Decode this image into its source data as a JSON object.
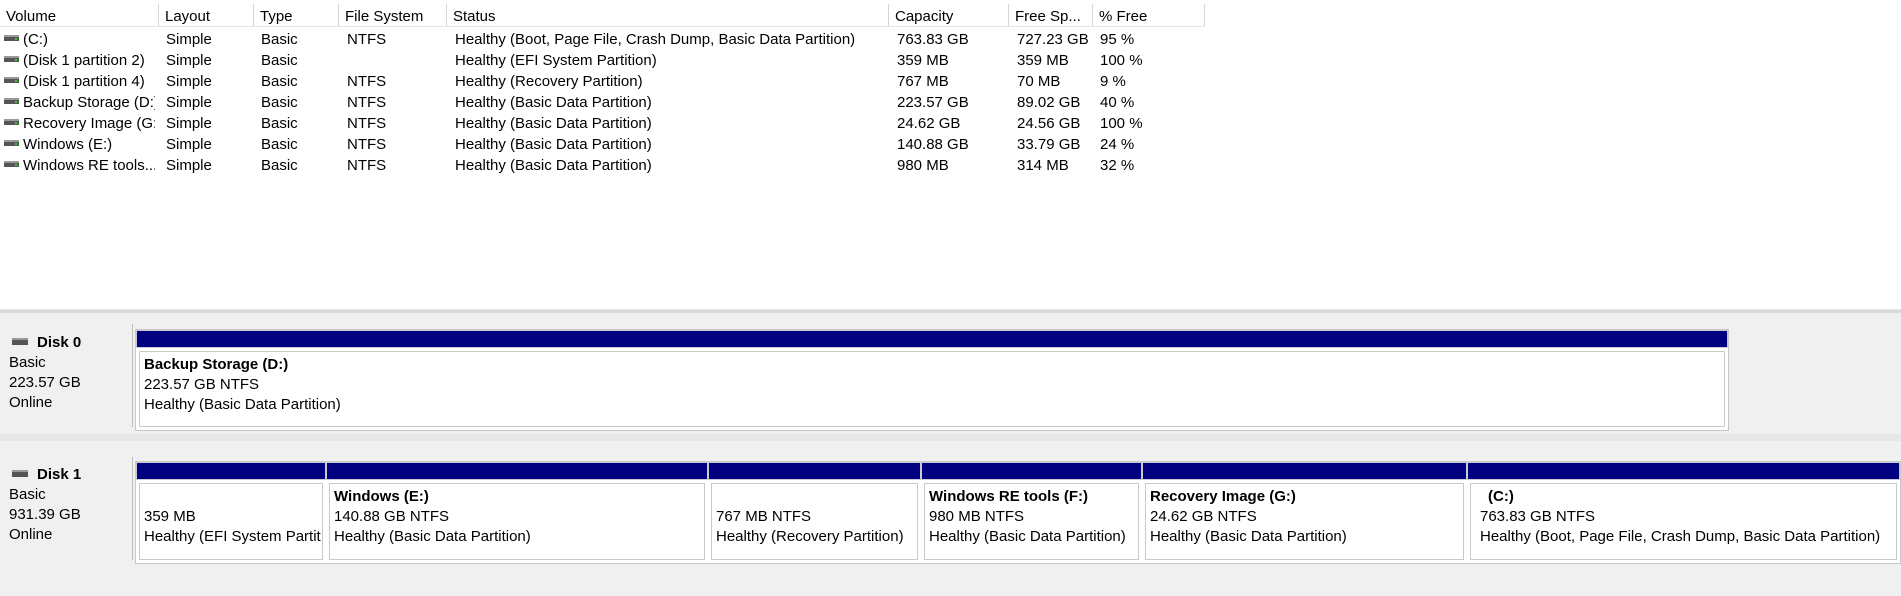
{
  "columns": [
    "Volume",
    "Layout",
    "Type",
    "File System",
    "Status",
    "Capacity",
    "Free Sp...",
    "% Free"
  ],
  "volumes": [
    {
      "volume": "(C:)",
      "layout": "Simple",
      "type": "Basic",
      "fs": "NTFS",
      "status": "Healthy (Boot, Page File, Crash Dump, Basic Data Partition)",
      "capacity": "763.83 GB",
      "free": "727.23 GB",
      "pct": "95 %"
    },
    {
      "volume": "(Disk 1 partition 2)",
      "layout": "Simple",
      "type": "Basic",
      "fs": "",
      "status": "Healthy (EFI System Partition)",
      "capacity": "359 MB",
      "free": "359 MB",
      "pct": "100 %"
    },
    {
      "volume": "(Disk 1 partition 4)",
      "layout": "Simple",
      "type": "Basic",
      "fs": "NTFS",
      "status": "Healthy (Recovery Partition)",
      "capacity": "767 MB",
      "free": "70 MB",
      "pct": "9 %"
    },
    {
      "volume": "Backup Storage (D:)",
      "layout": "Simple",
      "type": "Basic",
      "fs": "NTFS",
      "status": "Healthy (Basic Data Partition)",
      "capacity": "223.57 GB",
      "free": "89.02 GB",
      "pct": "40 %"
    },
    {
      "volume": "Recovery Image (G:)",
      "layout": "Simple",
      "type": "Basic",
      "fs": "NTFS",
      "status": "Healthy (Basic Data Partition)",
      "capacity": "24.62 GB",
      "free": "24.56 GB",
      "pct": "100 %"
    },
    {
      "volume": "Windows (E:)",
      "layout": "Simple",
      "type": "Basic",
      "fs": "NTFS",
      "status": "Healthy (Basic Data Partition)",
      "capacity": "140.88 GB",
      "free": "33.79 GB",
      "pct": "24 %"
    },
    {
      "volume": "Windows RE tools...",
      "layout": "Simple",
      "type": "Basic",
      "fs": "NTFS",
      "status": "Healthy (Basic Data Partition)",
      "capacity": "980 MB",
      "free": "314 MB",
      "pct": "32 %"
    }
  ],
  "disks": [
    {
      "name": "Disk 0",
      "type": "Basic",
      "size": "223.57 GB",
      "status": "Online",
      "partitions": [
        {
          "title": "Backup Storage  (D:)",
          "size": "223.57 GB NTFS",
          "status": "Healthy (Basic Data Partition)"
        }
      ]
    },
    {
      "name": "Disk 1",
      "type": "Basic",
      "size": "931.39 GB",
      "status": "Online",
      "partitions": [
        {
          "title": "",
          "size": "359 MB",
          "status": "Healthy (EFI System Partit"
        },
        {
          "title": "Windows  (E:)",
          "size": "140.88 GB NTFS",
          "status": "Healthy (Basic Data Partition)"
        },
        {
          "title": "",
          "size": "767 MB NTFS",
          "status": "Healthy (Recovery Partition)"
        },
        {
          "title": "Windows RE tools  (F:)",
          "size": "980 MB NTFS",
          "status": "Healthy (Basic Data Partition)"
        },
        {
          "title": "Recovery Image  (G:)",
          "size": "24.62 GB NTFS",
          "status": "Healthy (Basic Data Partition)"
        },
        {
          "title": "(C:)",
          "size": "763.83 GB NTFS",
          "status": "Healthy (Boot, Page File, Crash Dump, Basic Data Partition)"
        }
      ]
    }
  ]
}
